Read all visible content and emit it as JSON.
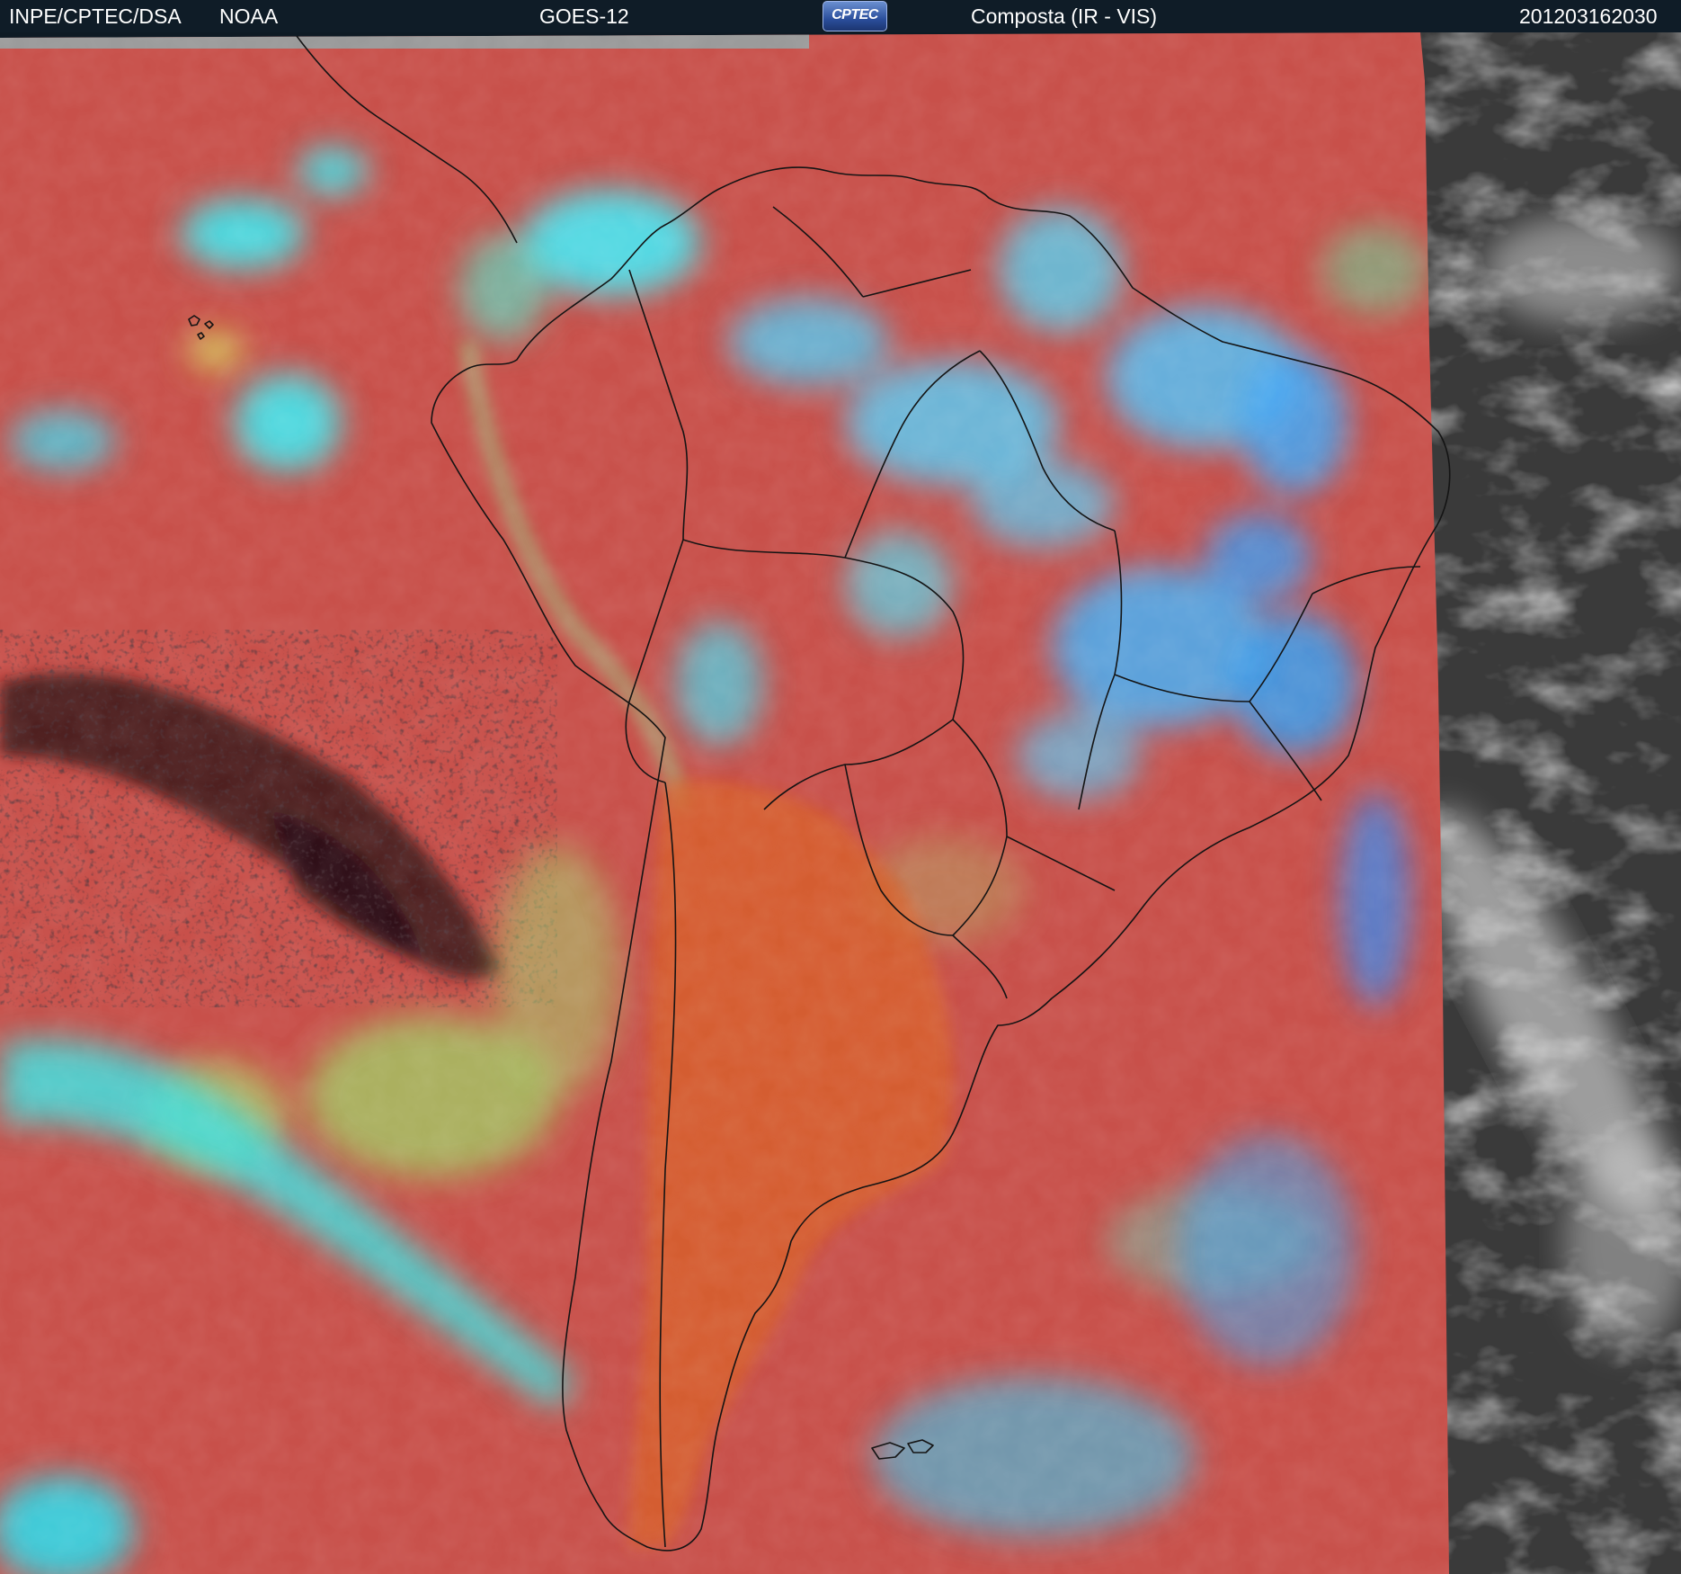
{
  "header": {
    "agency": "INPE/CPTEC/DSA",
    "noaa": "NOAA",
    "satellite": "GOES-12",
    "logo": "CPTEC",
    "product": "Composta (IR - VIS)",
    "timestamp": "201203162030"
  },
  "colors": {
    "header_bg": "#0f1c27",
    "clear_ocean": "#c8504a",
    "land_clear": "#d2583a",
    "high_cloud": "#33e6f0",
    "mid_cloud": "#9ed868",
    "cold_cloud_black": "#1a0d10",
    "vis_only_gray": "#3a3a3a",
    "border_lines": "#141414"
  }
}
